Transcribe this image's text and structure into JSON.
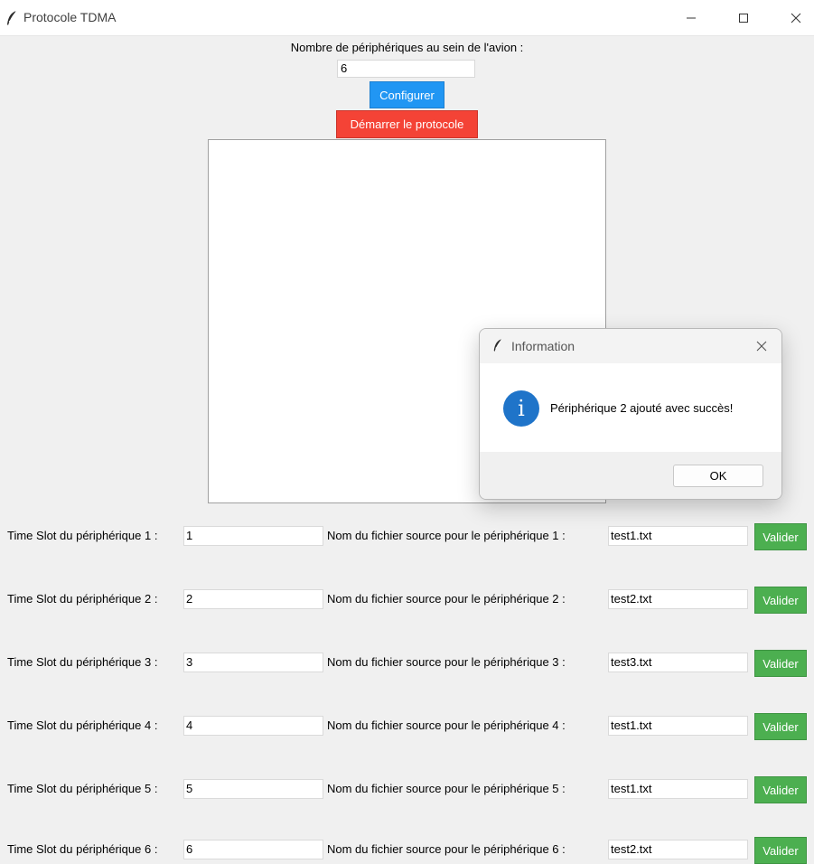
{
  "window": {
    "title": "Protocole TDMA"
  },
  "config": {
    "label": "Nombre de périphériques au sein de l'avion :",
    "count_value": "6",
    "configure_label": "Configurer",
    "start_label": "Démarrer le protocole"
  },
  "devices": [
    {
      "ts_label": "Time Slot du périphérique 1 :",
      "ts_value": "1",
      "file_label": "Nom du fichier source pour le périphérique 1 :",
      "file_value": "test1.txt",
      "validate_label": "Valider"
    },
    {
      "ts_label": "Time Slot du périphérique 2 :",
      "ts_value": "2",
      "file_label": "Nom du fichier source pour le périphérique 2 :",
      "file_value": "test2.txt",
      "validate_label": "Valider"
    },
    {
      "ts_label": "Time Slot du périphérique 3 :",
      "ts_value": "3",
      "file_label": "Nom du fichier source pour le périphérique 3 :",
      "file_value": "test3.txt",
      "validate_label": "Valider"
    },
    {
      "ts_label": "Time Slot du périphérique 4 :",
      "ts_value": "4",
      "file_label": "Nom du fichier source pour le périphérique 4 :",
      "file_value": "test1.txt",
      "validate_label": "Valider"
    },
    {
      "ts_label": "Time Slot du périphérique 5 :",
      "ts_value": "5",
      "file_label": "Nom du fichier source pour le périphérique 5 :",
      "file_value": "test1.txt",
      "validate_label": "Valider"
    },
    {
      "ts_label": "Time Slot du périphérique 6 :",
      "ts_value": "6",
      "file_label": "Nom du fichier source pour le périphérique 6 :",
      "file_value": "test2.txt",
      "validate_label": "Valider"
    }
  ],
  "dialog": {
    "title": "Information",
    "message": "Périphérique 2 ajouté avec succès!",
    "ok_label": "OK",
    "info_glyph": "i"
  },
  "colors": {
    "configure": "#2196f3",
    "start": "#f44336",
    "validate": "#4caf50",
    "info_icon": "#1f74c9"
  },
  "icons": [
    "feather-icon",
    "minimize-icon",
    "maximize-icon",
    "close-icon",
    "info-icon"
  ]
}
